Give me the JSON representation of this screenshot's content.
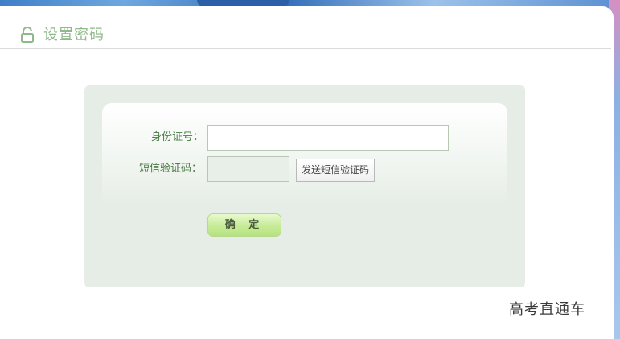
{
  "header": {
    "title": "设置密码",
    "icon": "lock-open-icon",
    "accent_color": "#8fb98a"
  },
  "form": {
    "id_number_label": "身份证号：",
    "id_number_value": "",
    "sms_code_label": "短信验证码：",
    "sms_code_value": "",
    "send_sms_button": "发送短信验证码",
    "confirm_button": "确 定"
  },
  "watermark": "高考直通车"
}
